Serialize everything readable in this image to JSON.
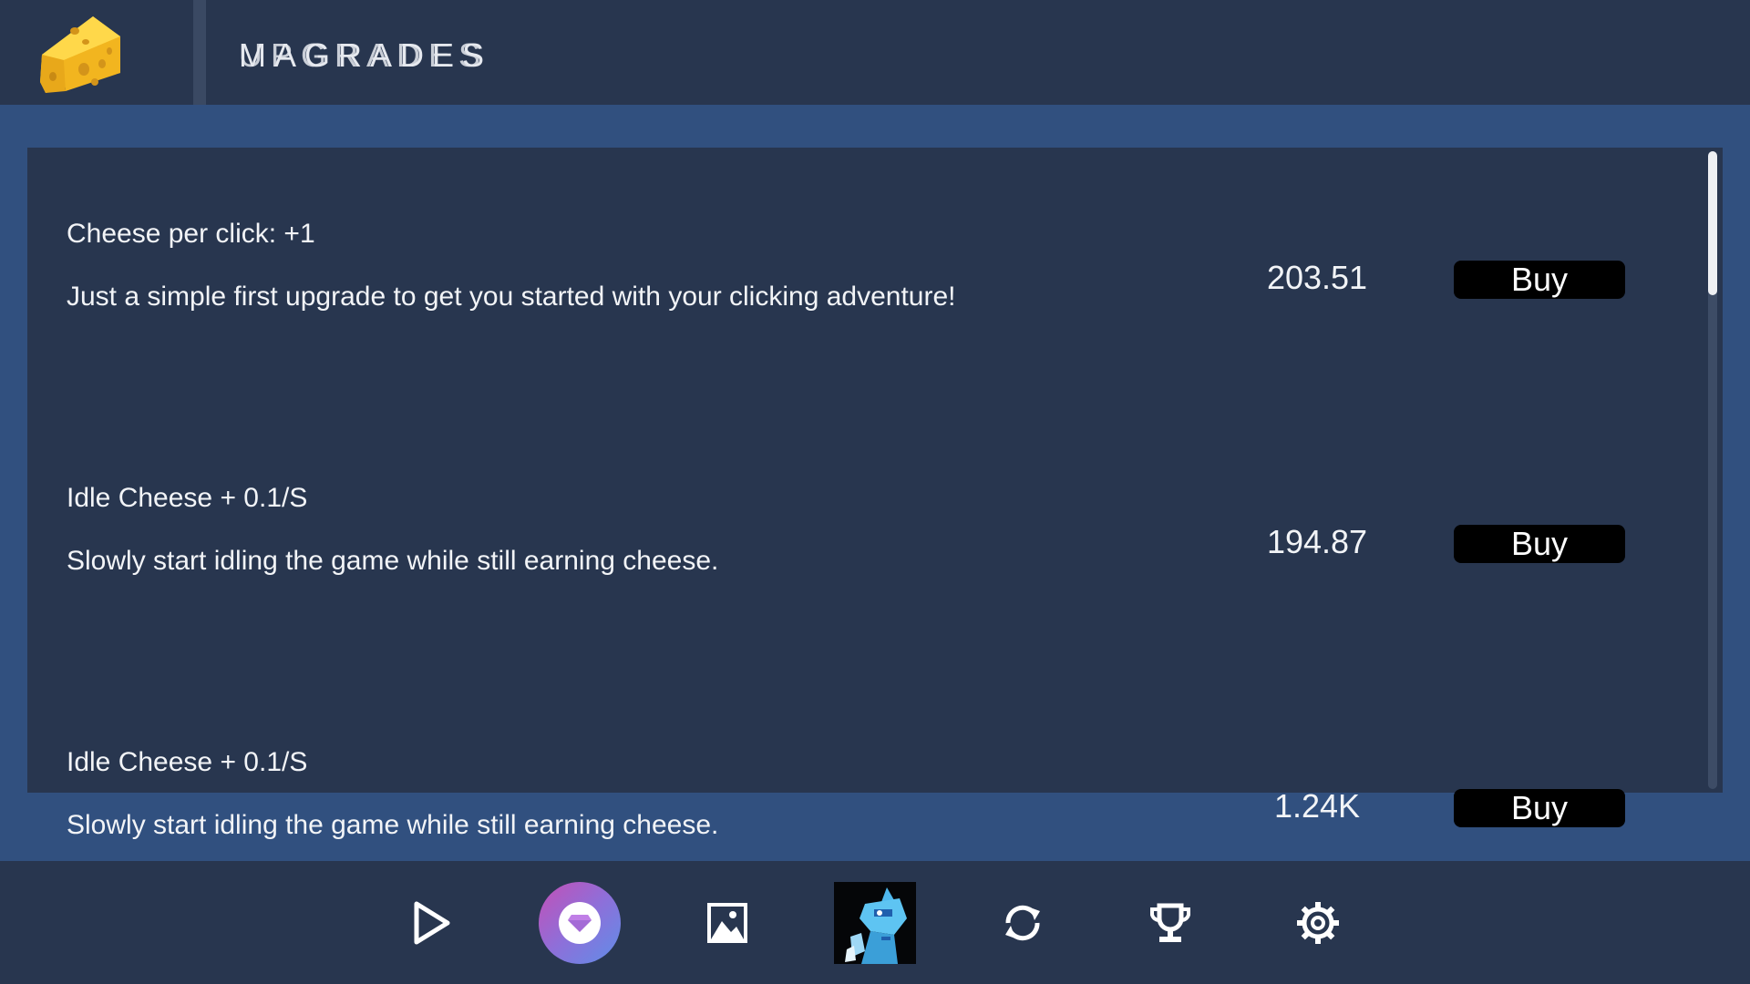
{
  "header": {
    "title_layer1": "MAGRADES",
    "title_layer2": "UPGRADES"
  },
  "upgrades": [
    {
      "title": "Cheese per click: +1",
      "description": "Just a simple first upgrade to get you started with your clicking adventure!",
      "price": "203.51",
      "buy_label": "Buy"
    },
    {
      "title": "Idle Cheese + 0.1/S",
      "description": "Slowly start idling the game while still earning cheese.",
      "price": "194.87",
      "buy_label": "Buy"
    },
    {
      "title": "Idle Cheese + 0.1/S",
      "description": "Slowly start idling the game while still earning cheese.",
      "price": "1.24K",
      "buy_label": "Buy"
    }
  ],
  "nav": [
    {
      "icon": "play-icon"
    },
    {
      "icon": "shop-gem-icon",
      "active": true
    },
    {
      "icon": "gallery-icon"
    },
    {
      "icon": "character-avatar"
    },
    {
      "icon": "refresh-icon"
    },
    {
      "icon": "trophy-icon"
    },
    {
      "icon": "settings-gear-icon"
    }
  ],
  "colors": {
    "background": "#31507f",
    "panel": "#28364f",
    "button": "#000000",
    "accent_gradient_start": "#c44fb6",
    "accent_gradient_end": "#5f8ee8"
  }
}
